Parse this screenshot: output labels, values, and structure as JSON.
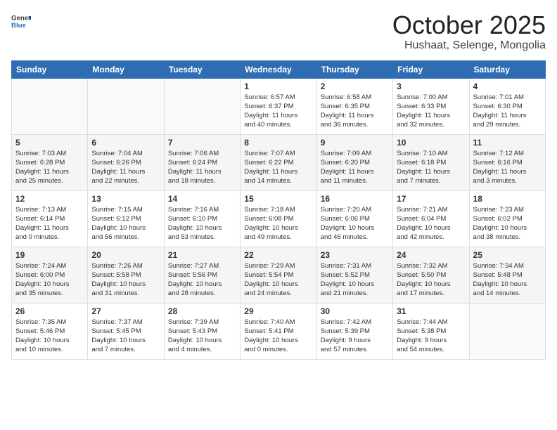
{
  "logo": {
    "text_general": "General",
    "text_blue": "Blue"
  },
  "header": {
    "month": "October 2025",
    "location": "Hushaat, Selenge, Mongolia"
  },
  "weekdays": [
    "Sunday",
    "Monday",
    "Tuesday",
    "Wednesday",
    "Thursday",
    "Friday",
    "Saturday"
  ],
  "weeks": [
    [
      {
        "day": "",
        "info": ""
      },
      {
        "day": "",
        "info": ""
      },
      {
        "day": "",
        "info": ""
      },
      {
        "day": "1",
        "info": "Sunrise: 6:57 AM\nSunset: 6:37 PM\nDaylight: 11 hours\nand 40 minutes."
      },
      {
        "day": "2",
        "info": "Sunrise: 6:58 AM\nSunset: 6:35 PM\nDaylight: 11 hours\nand 36 minutes."
      },
      {
        "day": "3",
        "info": "Sunrise: 7:00 AM\nSunset: 6:33 PM\nDaylight: 11 hours\nand 32 minutes."
      },
      {
        "day": "4",
        "info": "Sunrise: 7:01 AM\nSunset: 6:30 PM\nDaylight: 11 hours\nand 29 minutes."
      }
    ],
    [
      {
        "day": "5",
        "info": "Sunrise: 7:03 AM\nSunset: 6:28 PM\nDaylight: 11 hours\nand 25 minutes."
      },
      {
        "day": "6",
        "info": "Sunrise: 7:04 AM\nSunset: 6:26 PM\nDaylight: 11 hours\nand 22 minutes."
      },
      {
        "day": "7",
        "info": "Sunrise: 7:06 AM\nSunset: 6:24 PM\nDaylight: 11 hours\nand 18 minutes."
      },
      {
        "day": "8",
        "info": "Sunrise: 7:07 AM\nSunset: 6:22 PM\nDaylight: 11 hours\nand 14 minutes."
      },
      {
        "day": "9",
        "info": "Sunrise: 7:09 AM\nSunset: 6:20 PM\nDaylight: 11 hours\nand 11 minutes."
      },
      {
        "day": "10",
        "info": "Sunrise: 7:10 AM\nSunset: 6:18 PM\nDaylight: 11 hours\nand 7 minutes."
      },
      {
        "day": "11",
        "info": "Sunrise: 7:12 AM\nSunset: 6:16 PM\nDaylight: 11 hours\nand 3 minutes."
      }
    ],
    [
      {
        "day": "12",
        "info": "Sunrise: 7:13 AM\nSunset: 6:14 PM\nDaylight: 11 hours\nand 0 minutes."
      },
      {
        "day": "13",
        "info": "Sunrise: 7:15 AM\nSunset: 6:12 PM\nDaylight: 10 hours\nand 56 minutes."
      },
      {
        "day": "14",
        "info": "Sunrise: 7:16 AM\nSunset: 6:10 PM\nDaylight: 10 hours\nand 53 minutes."
      },
      {
        "day": "15",
        "info": "Sunrise: 7:18 AM\nSunset: 6:08 PM\nDaylight: 10 hours\nand 49 minutes."
      },
      {
        "day": "16",
        "info": "Sunrise: 7:20 AM\nSunset: 6:06 PM\nDaylight: 10 hours\nand 46 minutes."
      },
      {
        "day": "17",
        "info": "Sunrise: 7:21 AM\nSunset: 6:04 PM\nDaylight: 10 hours\nand 42 minutes."
      },
      {
        "day": "18",
        "info": "Sunrise: 7:23 AM\nSunset: 6:02 PM\nDaylight: 10 hours\nand 38 minutes."
      }
    ],
    [
      {
        "day": "19",
        "info": "Sunrise: 7:24 AM\nSunset: 6:00 PM\nDaylight: 10 hours\nand 35 minutes."
      },
      {
        "day": "20",
        "info": "Sunrise: 7:26 AM\nSunset: 5:58 PM\nDaylight: 10 hours\nand 31 minutes."
      },
      {
        "day": "21",
        "info": "Sunrise: 7:27 AM\nSunset: 5:56 PM\nDaylight: 10 hours\nand 28 minutes."
      },
      {
        "day": "22",
        "info": "Sunrise: 7:29 AM\nSunset: 5:54 PM\nDaylight: 10 hours\nand 24 minutes."
      },
      {
        "day": "23",
        "info": "Sunrise: 7:31 AM\nSunset: 5:52 PM\nDaylight: 10 hours\nand 21 minutes."
      },
      {
        "day": "24",
        "info": "Sunrise: 7:32 AM\nSunset: 5:50 PM\nDaylight: 10 hours\nand 17 minutes."
      },
      {
        "day": "25",
        "info": "Sunrise: 7:34 AM\nSunset: 5:48 PM\nDaylight: 10 hours\nand 14 minutes."
      }
    ],
    [
      {
        "day": "26",
        "info": "Sunrise: 7:35 AM\nSunset: 5:46 PM\nDaylight: 10 hours\nand 10 minutes."
      },
      {
        "day": "27",
        "info": "Sunrise: 7:37 AM\nSunset: 5:45 PM\nDaylight: 10 hours\nand 7 minutes."
      },
      {
        "day": "28",
        "info": "Sunrise: 7:39 AM\nSunset: 5:43 PM\nDaylight: 10 hours\nand 4 minutes."
      },
      {
        "day": "29",
        "info": "Sunrise: 7:40 AM\nSunset: 5:41 PM\nDaylight: 10 hours\nand 0 minutes."
      },
      {
        "day": "30",
        "info": "Sunrise: 7:42 AM\nSunset: 5:39 PM\nDaylight: 9 hours\nand 57 minutes."
      },
      {
        "day": "31",
        "info": "Sunrise: 7:44 AM\nSunset: 5:38 PM\nDaylight: 9 hours\nand 54 minutes."
      },
      {
        "day": "",
        "info": ""
      }
    ]
  ]
}
